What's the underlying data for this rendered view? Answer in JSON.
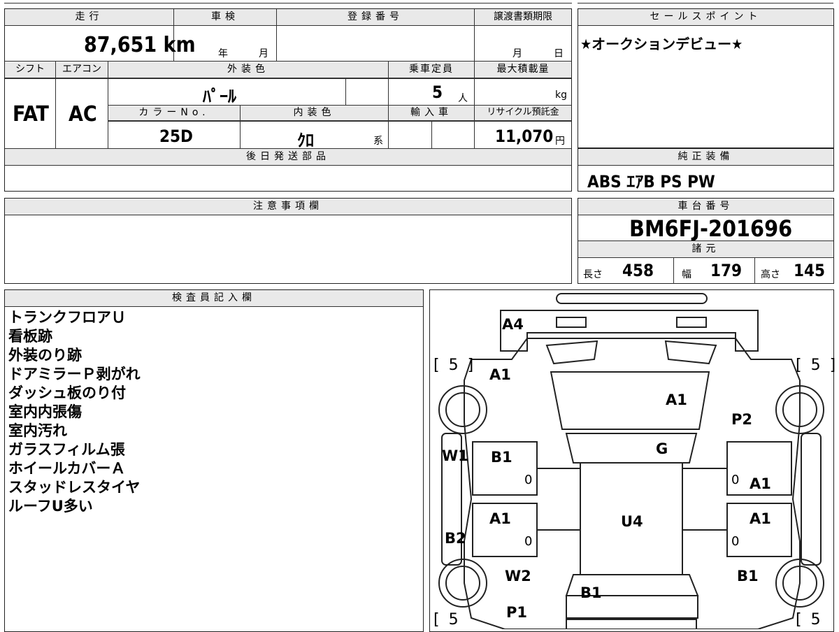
{
  "top": {
    "mileage_label": "走行",
    "mileage_value": "87,651",
    "mileage_unit": "km",
    "shaken_label": "車検",
    "shaken_year": "年",
    "shaken_month": "月",
    "reg_label": "登録番号",
    "transfer_label": "譲渡書類期限",
    "transfer_month": "月",
    "transfer_day": "日"
  },
  "sales": {
    "label": "セールスポイント",
    "text": "★オークションデビュー★"
  },
  "specs": {
    "shift_label": "シフト",
    "shift_value": "FAT",
    "ac_label": "エアコン",
    "ac_value": "AC",
    "ext_color_label": "外装色",
    "ext_color_value": "ﾊﾟｰﾙ",
    "capacity_label": "乗車定員",
    "capacity_value": "5",
    "capacity_unit": "人",
    "load_label": "最大積載量",
    "load_unit": "kg",
    "color_no_label": "カラーNo.",
    "color_no_value": "25D",
    "int_color_label": "内装色",
    "int_color_value": "ｸﾛ",
    "int_color_suffix": "系",
    "import_label": "輸入車",
    "recycle_label": "リサイクル預託金",
    "recycle_value": "11,070",
    "recycle_unit": "円"
  },
  "later_parts": {
    "label": "後日発送部品"
  },
  "equipment": {
    "label": "純正装備",
    "value": "ABS ｴｱB PS PW"
  },
  "notes": {
    "label": "注意事項欄"
  },
  "chassis": {
    "label": "車台番号",
    "value": "BM6FJ-201696"
  },
  "dims": {
    "label": "諸元",
    "length_label": "長さ",
    "length_value": "458",
    "width_label": "幅",
    "width_value": "179",
    "height_label": "高さ",
    "height_value": "145"
  },
  "inspector": {
    "label": "検査員記入欄",
    "items": [
      "トランクフロアＵ",
      "看板跡",
      "外装のり跡",
      "ドアミラーＰ剥がれ",
      "ダッシュ板のり付",
      "室内内張傷",
      "室内汚れ",
      "ガラスフィルム張",
      "ホイールカバーＡ",
      "スタッドレスタイヤ",
      "ルーフU多い"
    ]
  },
  "diagram": {
    "tire_tl": "[ 5 ]",
    "tire_tr": "[ 5 ]",
    "tire_bl": "[ 5",
    "tire_br": "[ 5",
    "labels": {
      "a4": "A4",
      "a1_tl": "A1",
      "a1_hood": "A1",
      "p2": "P2",
      "g": "G",
      "w1": "W1",
      "b1_fl": "B1",
      "zero_fl": "0",
      "zero_fr": "0",
      "a1_fr": "A1",
      "a1_rl": "A1",
      "u4": "U4",
      "a1_rr": "A1",
      "b2": "B2",
      "zero_rl": "0",
      "zero_rr": "0",
      "w2": "W2",
      "b1_rear_r": "B1",
      "b1_trunk": "B1",
      "p1": "P1"
    }
  }
}
